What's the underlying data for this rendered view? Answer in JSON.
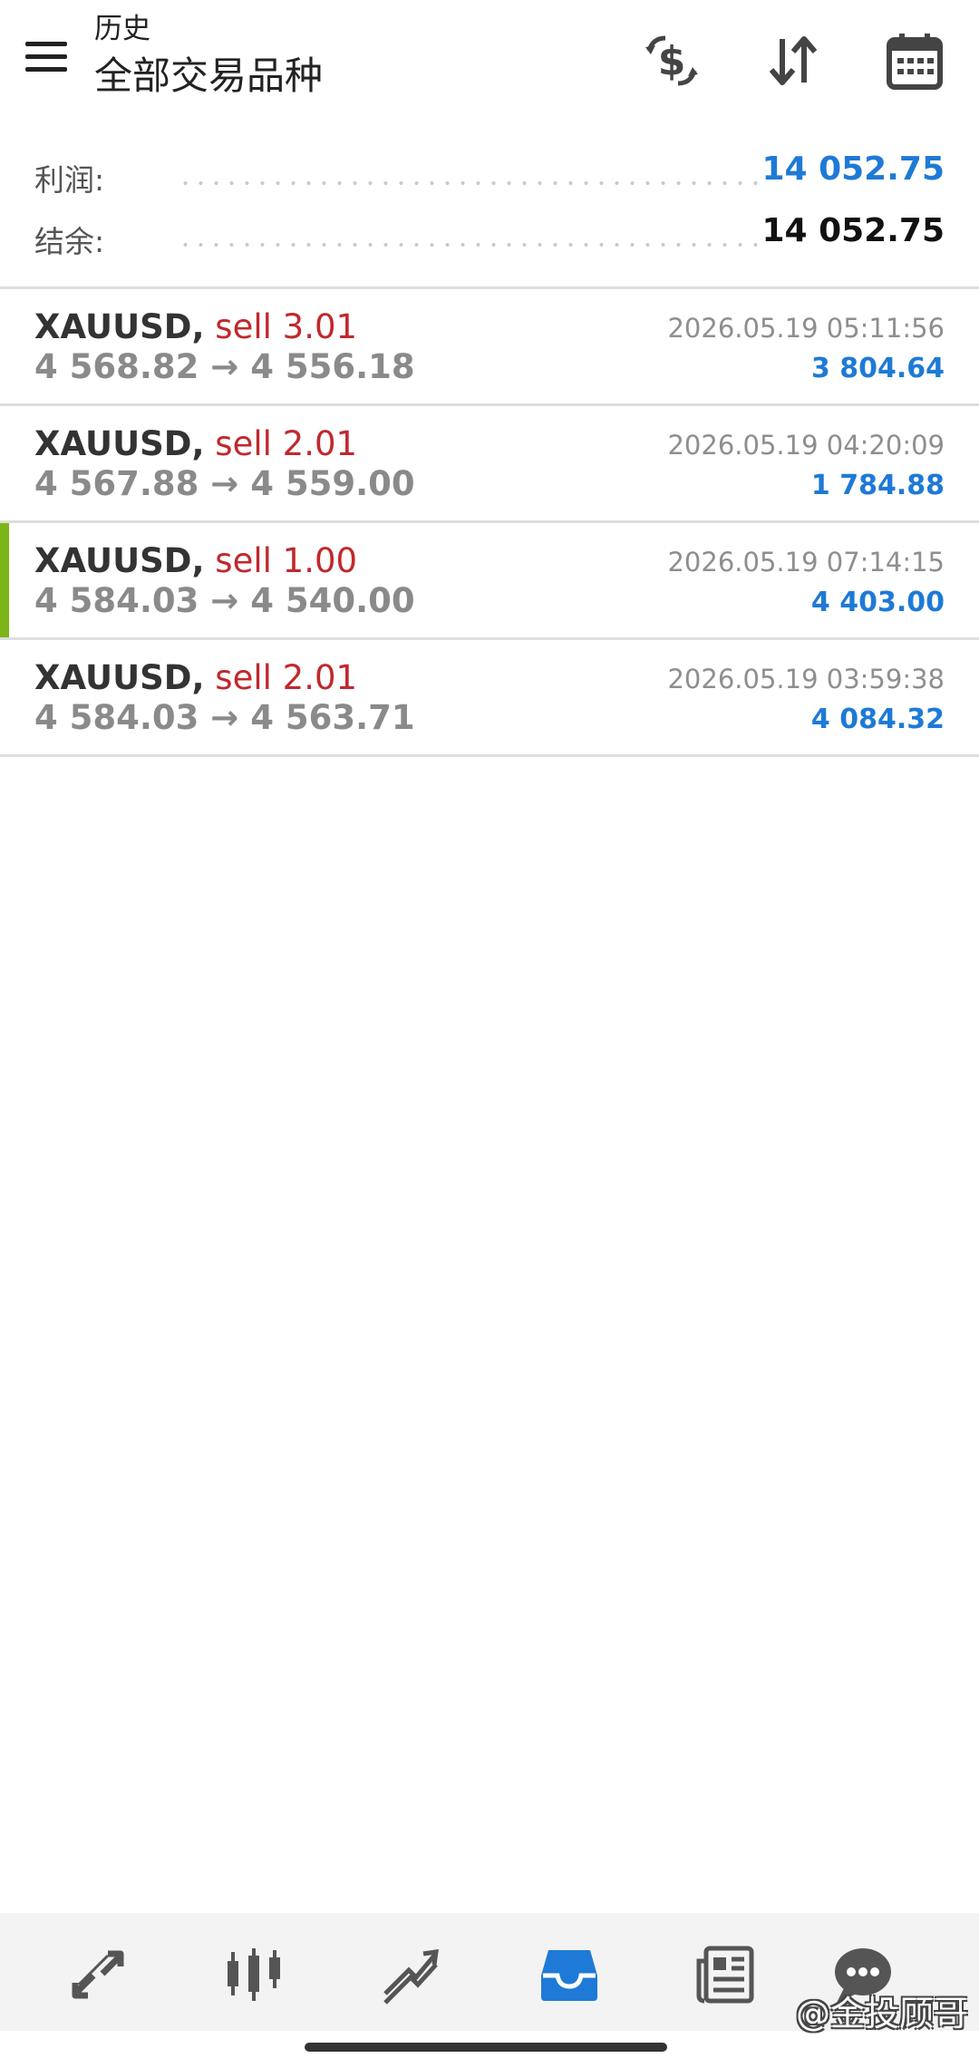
{
  "header": {
    "title_small": "历史",
    "title_main": "全部交易品种",
    "icons": [
      "menu-icon",
      "dollar-exchange-icon",
      "sort-icon",
      "calendar-icon"
    ]
  },
  "summary": {
    "profit_label": "利润:",
    "profit_value": "14 052.75",
    "balance_label": "结余:",
    "balance_value": "14 052.75"
  },
  "deals": [
    {
      "symbol": "XAUUSD,",
      "side": "sell 3.01",
      "open": "4 568.82",
      "arrow": "→",
      "close": "4 556.18",
      "time": "2026.05.19 05:11:56",
      "profit": "3 804.64",
      "selected": false
    },
    {
      "symbol": "XAUUSD,",
      "side": "sell 2.01",
      "open": "4 567.88",
      "arrow": "→",
      "close": "4 559.00",
      "time": "2026.05.19 04:20:09",
      "profit": "1 784.88",
      "selected": false
    },
    {
      "symbol": "XAUUSD,",
      "side": "sell 1.00",
      "open": "4 584.03",
      "arrow": "→",
      "close": "4 540.00",
      "time": "2026.05.19 07:14:15",
      "profit": "4 403.00",
      "selected": true
    },
    {
      "symbol": "XAUUSD,",
      "side": "sell 2.01",
      "open": "4 584.03",
      "arrow": "→",
      "close": "4 563.71",
      "time": "2026.05.19 03:59:38",
      "profit": "4 084.32",
      "selected": false
    }
  ],
  "bottom_nav": {
    "items": [
      "quotes-icon",
      "chart-icon",
      "trade-icon",
      "history-icon",
      "news-icon",
      "chat-icon"
    ],
    "active": "history-icon"
  },
  "watermark": "@金投顾哥",
  "colors": {
    "accent_blue": "#1e7ad6",
    "sell_red": "#c0282d",
    "selected_green": "#7cb518",
    "icon_gray": "#555555"
  }
}
